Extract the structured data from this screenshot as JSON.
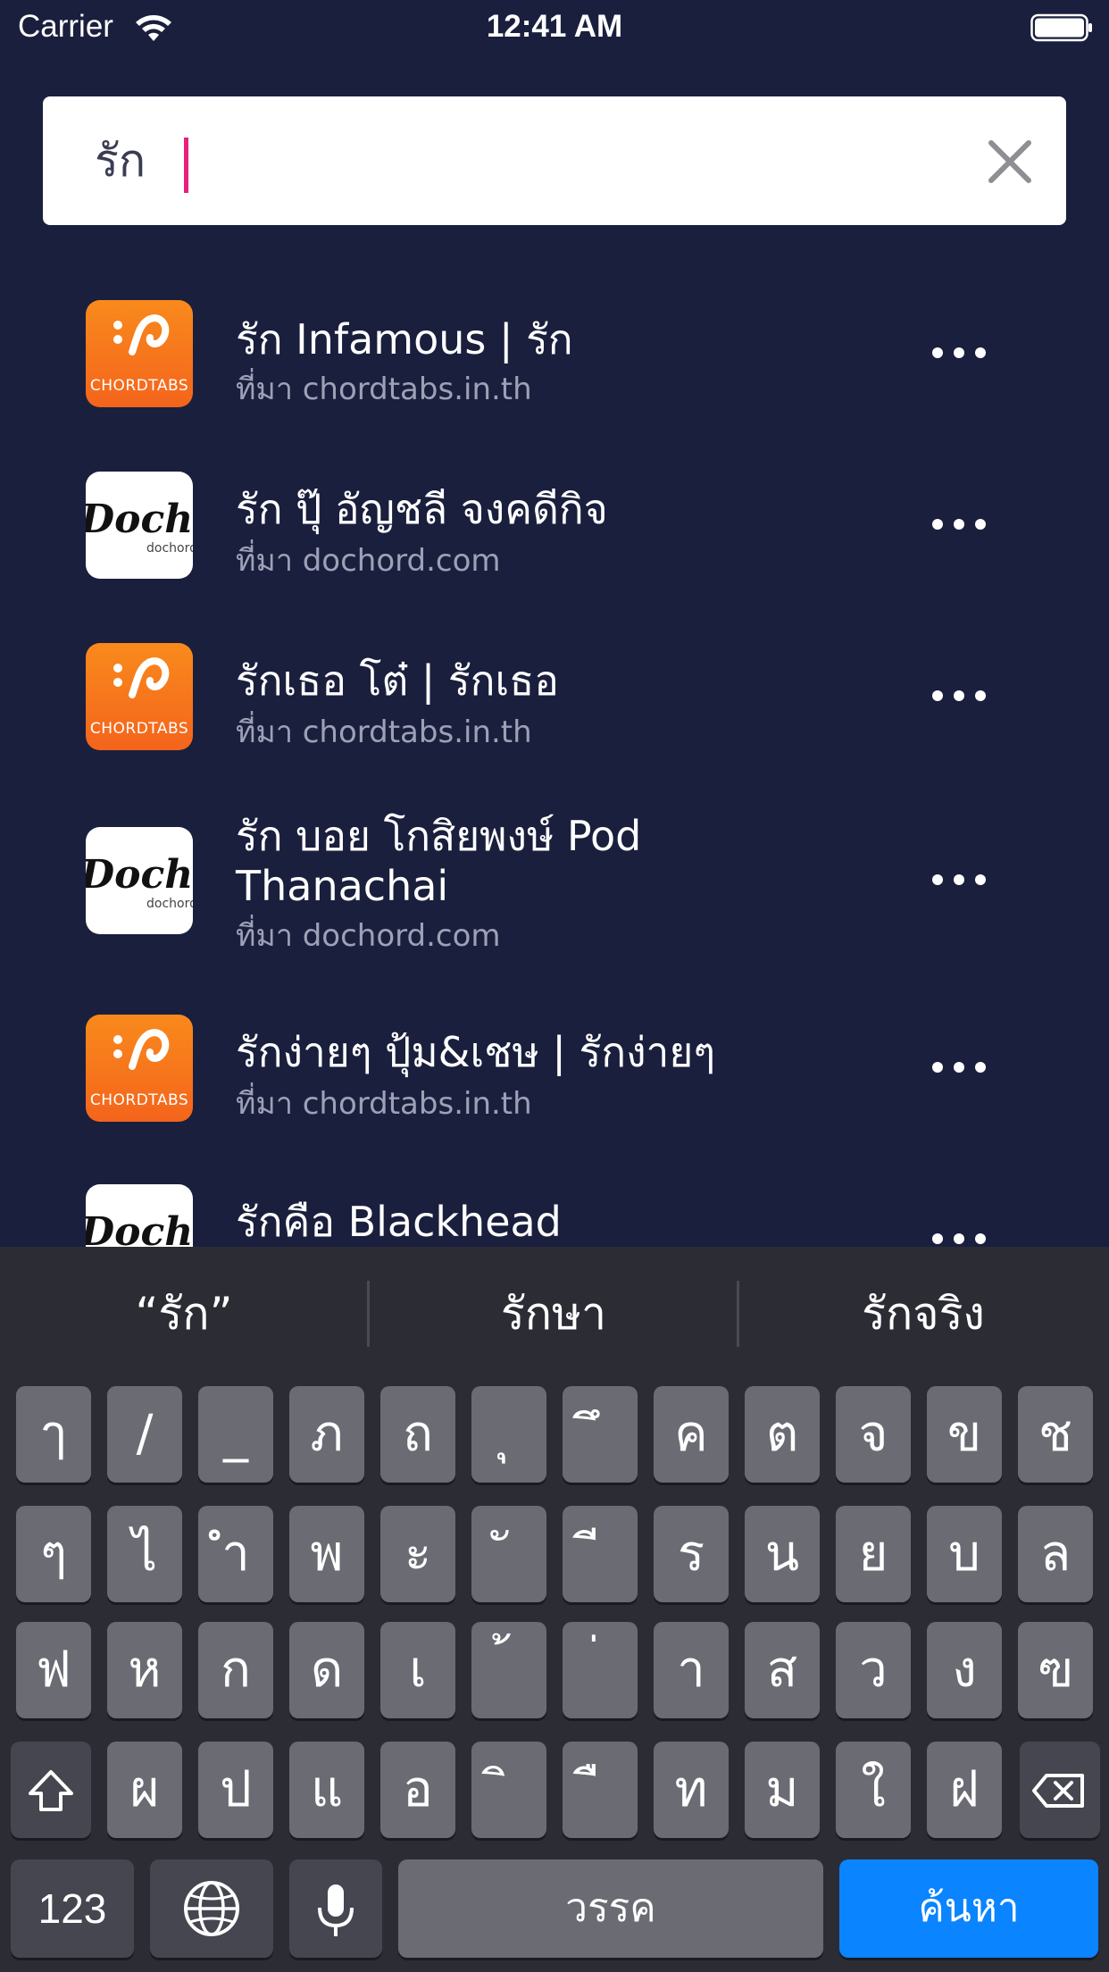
{
  "status": {
    "carrier": "Carrier",
    "time": "12:41 AM"
  },
  "search": {
    "value": "รัก",
    "clear_icon": "close-icon"
  },
  "results": [
    {
      "title": "รัก Infamous | รัก",
      "source": "ที่มา chordtabs.in.th",
      "thumb": "chordtabs",
      "thumb_label": "CHORDTABS"
    },
    {
      "title": "รัก ปุ๊ อัญชลี จงคดีกิจ",
      "source": "ที่มา dochord.com",
      "thumb": "dochord",
      "thumb_label": "dochord"
    },
    {
      "title": "รักเธอ โต๋ | รักเธอ",
      "source": "ที่มา chordtabs.in.th",
      "thumb": "chordtabs",
      "thumb_label": "CHORDTABS"
    },
    {
      "title": "รัก บอย โกสิยพงษ์ Pod Thanachai",
      "source": "ที่มา dochord.com",
      "thumb": "dochord",
      "thumb_label": "dochord"
    },
    {
      "title": "รักง่ายๆ ปุ้ม&เชษ | รักง่ายๆ",
      "source": "ที่มา chordtabs.in.th",
      "thumb": "chordtabs",
      "thumb_label": "CHORDTABS"
    },
    {
      "title": "รักคือ Blackhead",
      "source": "",
      "thumb": "dochord",
      "thumb_label": "dochord"
    }
  ],
  "keyboard": {
    "suggestions": [
      "“รัก”",
      "รักษา",
      "รักจริง"
    ],
    "row1": [
      "ๅ",
      "/",
      "_",
      "ภ",
      "ถ",
      "ุ",
      "ึ",
      "ค",
      "ต",
      "จ",
      "ข",
      "ช"
    ],
    "row2": [
      "ๆ",
      "ไ",
      "ำ",
      "พ",
      "ะ",
      "ั",
      "ี",
      "ร",
      "น",
      "ย",
      "บ",
      "ล"
    ],
    "row3": [
      "ฟ",
      "ห",
      "ก",
      "ด",
      "เ",
      "้",
      "่",
      "า",
      "ส",
      "ว",
      "ง",
      "ฃ"
    ],
    "row4": [
      "ผ",
      "ป",
      "แ",
      "อ",
      "ิ",
      "ื",
      "ท",
      "ม",
      "ใ",
      "ฝ"
    ],
    "numbers_label": "123",
    "space_label": "วรรค",
    "search_label": "ค้นหา",
    "shift_icon": "shift-icon",
    "delete_icon": "delete-icon",
    "globe_icon": "globe-icon",
    "mic_icon": "microphone-icon"
  }
}
